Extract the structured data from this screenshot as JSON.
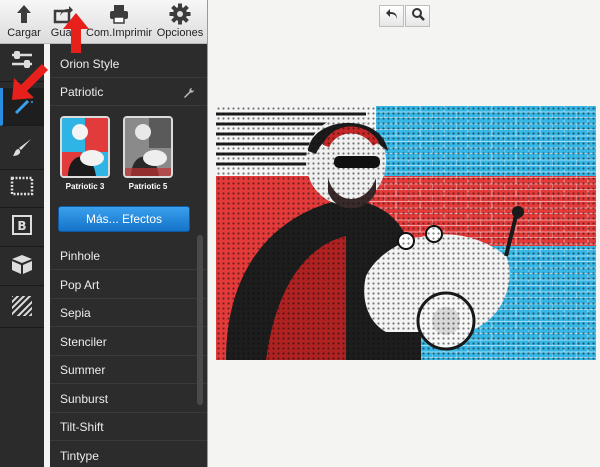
{
  "toolbar": {
    "buttons": [
      {
        "label": "Cargar",
        "icon": "upload-arrow-icon"
      },
      {
        "label": "Guar",
        "icon": "share-export-icon"
      },
      {
        "label": "Com.Imprimir",
        "icon": "printer-icon"
      },
      {
        "label": "Opciones",
        "icon": "gear-icon"
      }
    ]
  },
  "rail": {
    "items": [
      {
        "icon": "adjust-sliders-icon"
      },
      {
        "icon": "magic-wand-icon",
        "active": true
      },
      {
        "icon": "brush-icon"
      },
      {
        "icon": "frame-icon"
      },
      {
        "icon": "text-b-icon"
      },
      {
        "icon": "sticker-box-icon"
      },
      {
        "icon": "overlay-stripes-icon"
      }
    ]
  },
  "panel": {
    "top_item": "Orion Style",
    "current_group": "Patriotic",
    "thumbnails": [
      {
        "label": "Patriotic 3"
      },
      {
        "label": "Patriotic 5"
      }
    ],
    "more_button": "Más... Efectos",
    "effects": [
      "Pinhole",
      "Pop Art",
      "Sepia",
      "Stenciler",
      "Summer",
      "Sunburst",
      "Tilt-Shift",
      "Tintype"
    ]
  },
  "controls": {
    "undo_icon": "undo-icon",
    "zoom_icon": "zoom-icon"
  },
  "colors": {
    "accent_blue": "#2b8de0",
    "annotation_red": "#e8201c",
    "photo_red": "#e43a3a",
    "photo_cyan": "#37b7e6"
  }
}
